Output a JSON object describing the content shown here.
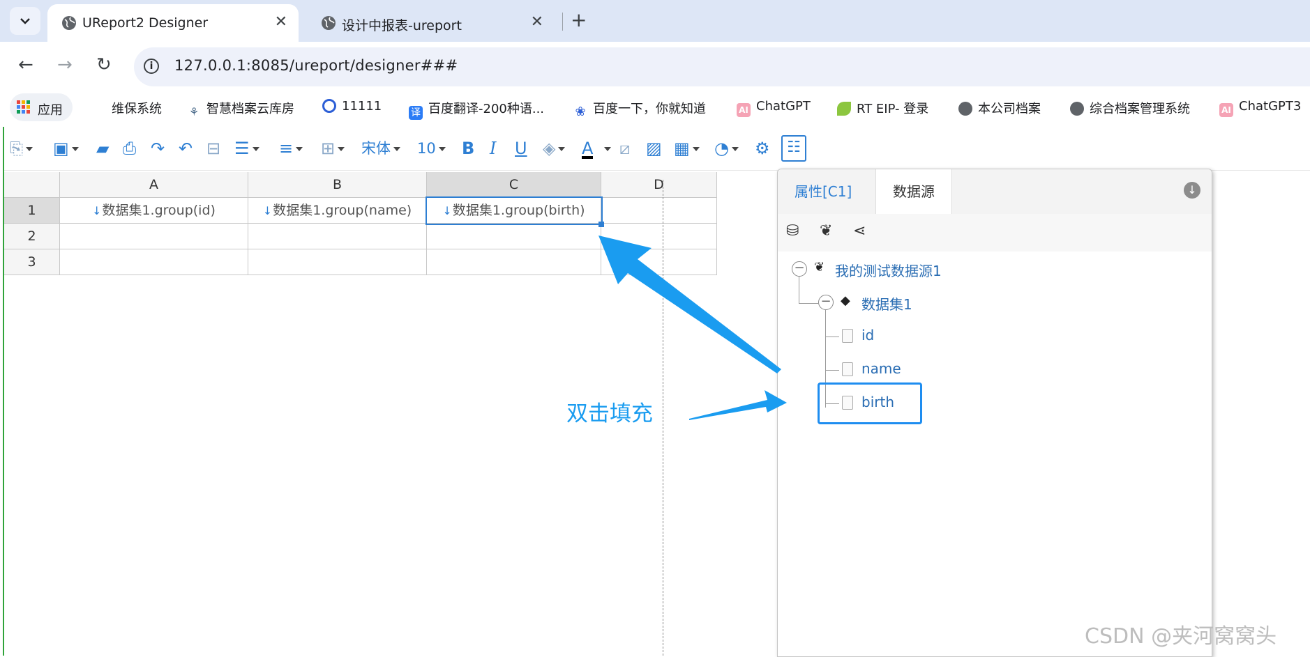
{
  "browser": {
    "tabs": [
      {
        "title": "UReport2 Designer",
        "active": true
      },
      {
        "title": "设计中报表-ureport",
        "active": false
      }
    ],
    "url": "127.0.0.1:8085/ureport/designer###",
    "new_tab_symbol": "+",
    "close_symbol": "✕"
  },
  "bookmarks": [
    {
      "label": "应用",
      "icon": "apps-grid-icon"
    },
    {
      "label": "维保系统",
      "icon": "none"
    },
    {
      "label": "智慧档案云库房",
      "icon": "lotus-icon"
    },
    {
      "label": "11111",
      "icon": "target-icon"
    },
    {
      "label": "百度翻译-200种语...",
      "icon": "baidu-translate-icon"
    },
    {
      "label": "百度一下，你就知道",
      "icon": "baidu-paw-icon"
    },
    {
      "label": "ChatGPT",
      "icon": "ai-icon"
    },
    {
      "label": "RT EIP- 登录",
      "icon": "leaf-icon"
    },
    {
      "label": "本公司档案",
      "icon": "globe-icon"
    },
    {
      "label": "综合档案管理系统",
      "icon": "globe-icon"
    },
    {
      "label": "ChatGPT3",
      "icon": "ai-icon"
    }
  ],
  "toolbar": {
    "font_name": "宋体",
    "font_size": "10",
    "bold": "B",
    "italic": "I",
    "underline": "U",
    "font_color_letter": "A"
  },
  "grid": {
    "columns": [
      "A",
      "B",
      "C",
      "D"
    ],
    "rows": [
      "1",
      "2",
      "3"
    ],
    "cells": {
      "A1": "数据集1.group(id)",
      "B1": "数据集1.group(name)",
      "C1": "数据集1.group(birth)"
    },
    "selected_cell": "C1"
  },
  "panel": {
    "tabs": [
      "属性[C1]",
      "数据源"
    ],
    "active_tab": "数据源",
    "tree": {
      "datasource": "我的测试数据源1",
      "dataset": "数据集1",
      "fields": [
        "id",
        "name",
        "birth"
      ],
      "highlighted_field": "birth"
    }
  },
  "annotation": {
    "text": "双击填充",
    "color": "#1a9cf0"
  },
  "watermark": "CSDN @夹河窝窝头",
  "colors": {
    "accent": "#2e7fd3",
    "tabstrip": "#dde6f6",
    "highlight": "#1e8df0"
  }
}
